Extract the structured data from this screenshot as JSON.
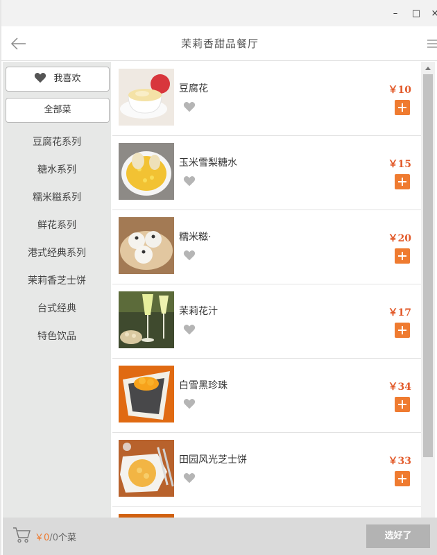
{
  "window": {
    "minimize_glyph": "–",
    "maximize_glyph": "□",
    "close_glyph": "×"
  },
  "header": {
    "title": "茉莉香甜品餐厅",
    "back_icon": "arrow-left-icon",
    "menu_icon": "hamburger-menu-icon"
  },
  "sidebar": {
    "favorites_label": "我喜欢",
    "all_label": "全部菜",
    "categories": [
      {
        "label": "豆腐花系列"
      },
      {
        "label": "糖水系列"
      },
      {
        "label": "糯米糍系列"
      },
      {
        "label": "鲜花系列"
      },
      {
        "label": "港式经典系列"
      },
      {
        "label": "茉莉香芝士饼"
      },
      {
        "label": "台式经典"
      },
      {
        "label": "特色饮品"
      }
    ]
  },
  "menu_items": [
    {
      "name": "豆腐花",
      "price": "￥10"
    },
    {
      "name": "玉米雪梨糖水",
      "price": "￥15"
    },
    {
      "name": "糯米糍·",
      "price": "￥20"
    },
    {
      "name": "茉莉花汁",
      "price": "￥17"
    },
    {
      "name": "白雪黑珍珠",
      "price": "￥34"
    },
    {
      "name": "田园风光芝士饼",
      "price": "￥33"
    }
  ],
  "cart": {
    "currency": "￥",
    "total": "0",
    "separator": "/",
    "count": "0",
    "unit": "个菜"
  },
  "footer": {
    "checkout_label": "选好了"
  },
  "colors": {
    "accent": "#ef7b30",
    "price": "#e25a2a",
    "sidebar_bg": "#e7e8e7",
    "footer_bg": "#dadada",
    "checkout_disabled": "#b3b3b3"
  }
}
